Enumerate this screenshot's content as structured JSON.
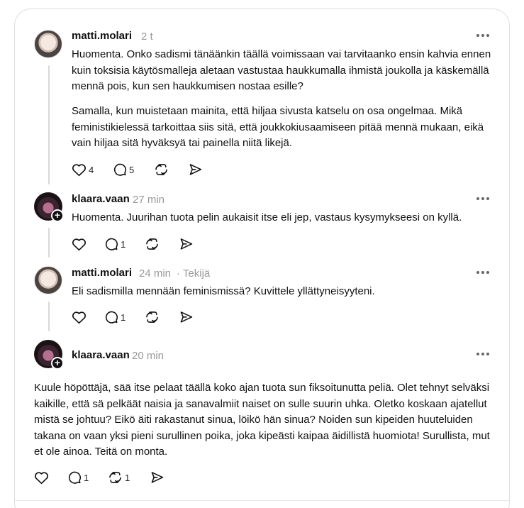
{
  "posts": [
    {
      "username": "matti.molari",
      "time": "2 t",
      "author_tag": "",
      "paragraphs": [
        "Huomenta. Onko sadismi tänäänkin täällä voimissaan vai tarvitaanko ensin kahvia ennen kuin toksisia käytösmalleja aletaan vastustaa haukkumalla ihmistä joukolla ja käskemällä mennä pois, kun sen haukkumisen nostaa esille?",
        "Samalla, kun muistetaan mainita, että hiljaa sivusta katselu on osa ongelmaa. Mikä feministikielessä tarkoittaa siis sitä, että joukkokiusaamiseen pitää mennä mukaan, eikä vain hiljaa sitä hyväksyä tai painella niitä likejä."
      ],
      "likes": "4",
      "replies": "5",
      "reposts": ""
    },
    {
      "username": "klaara.vaan",
      "time": "27 min",
      "author_tag": "",
      "paragraphs": [
        "Huomenta. Juurihan tuota pelin aukaisit itse eli jep, vastaus kysymykseesi on kyllä."
      ],
      "likes": "",
      "replies": "1",
      "reposts": ""
    },
    {
      "username": "matti.molari",
      "time": "24 min",
      "author_tag": "· Tekijä",
      "paragraphs": [
        "Eli sadismilla mennään feminismissä? Kuvittele yllättyneisyyteni."
      ],
      "likes": "",
      "replies": "1",
      "reposts": ""
    },
    {
      "username": "klaara.vaan",
      "time": "20 min",
      "author_tag": "",
      "paragraphs": [
        "Kuule höpöttäjä, sää itse pelaat täällä koko ajan tuota sun fiksoitunutta peliä. Olet tehnyt selväksi kaikille, että sä pelkäät naisia ja sanavalmiit naiset on sulle suurin uhka. Oletko koskaan ajatellut mistä se johtuu? Eikö äiti rakastanut sinua, löikö hän sinua? Noiden sun kipeiden huuteluiden takana on vaan yksi pieni surullinen poika, joka kipeästi kaipaa äidillistä huomiota! Surullista, mut et ole ainoa. Teitä on monta."
      ],
      "likes": "",
      "replies": "1",
      "reposts": "1"
    }
  ],
  "icons": {
    "like": "heart-icon",
    "reply": "comment-icon",
    "repost": "repost-icon",
    "share": "send-icon",
    "more": "more-options-icon",
    "follow": "plus-icon"
  },
  "colors": {
    "text": "#101010",
    "muted": "#999999",
    "thread_line": "#d9d9d9",
    "border": "#dedede"
  }
}
